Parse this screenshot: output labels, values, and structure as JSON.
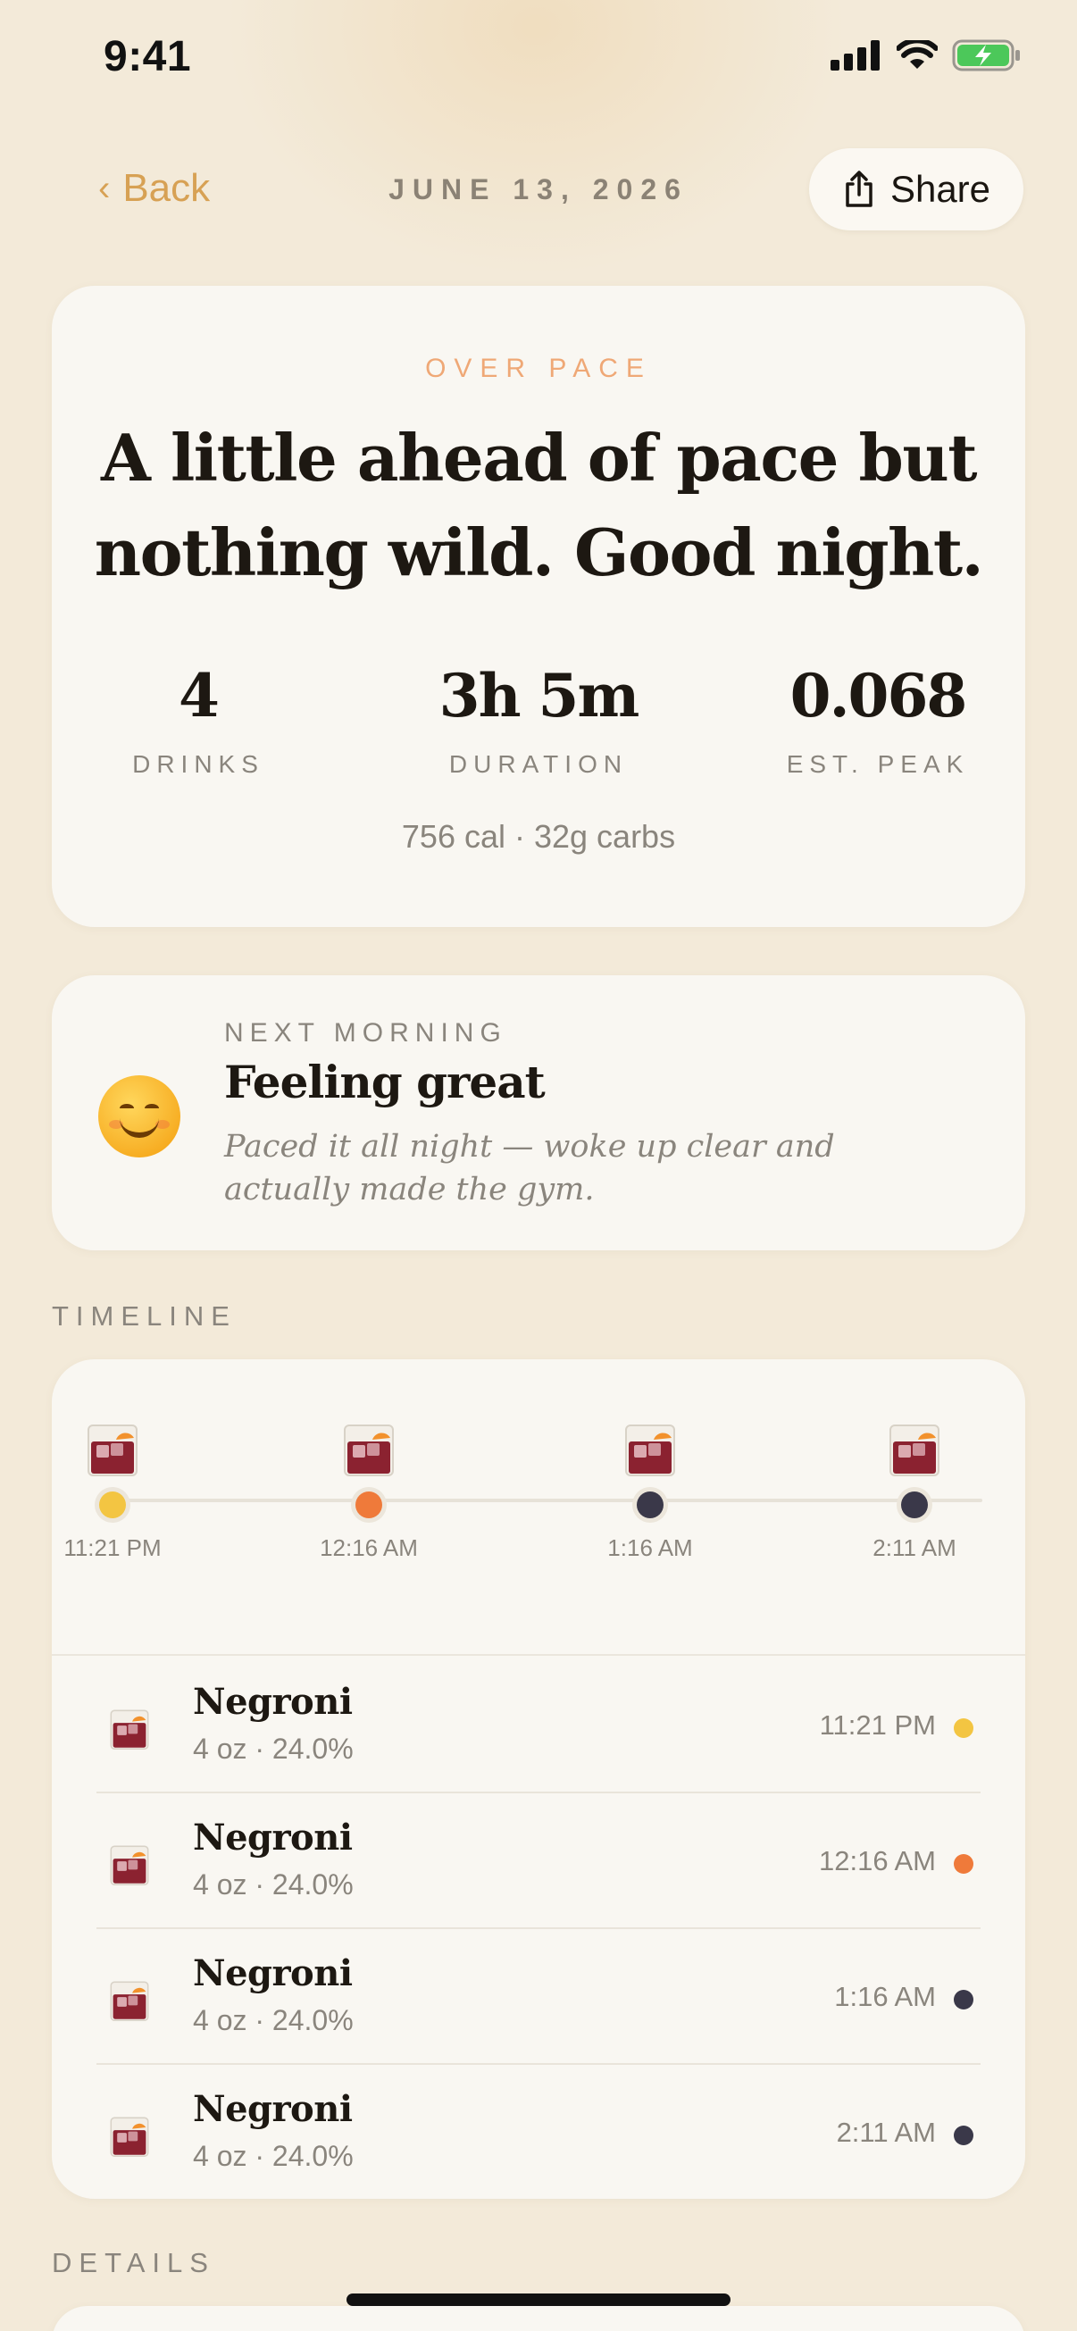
{
  "status_bar": {
    "time": "9:41"
  },
  "header": {
    "back_label": "Back",
    "date": "JUNE 13, 2026",
    "share_label": "Share"
  },
  "summary": {
    "pace_label": "OVER PACE",
    "headline": "A little ahead of pace but nothing wild. Good night.",
    "stats": [
      {
        "value": "4",
        "label": "DRINKS"
      },
      {
        "value": "3h 5m",
        "label": "DURATION"
      },
      {
        "value": "0.068",
        "label": "EST. PEAK"
      }
    ],
    "nutrition": "756 cal · 32g carbs"
  },
  "next_morning": {
    "label": "NEXT MORNING",
    "title": "Feeling great",
    "note": "Paced it all night — woke up clear and actually made the gym.",
    "icon": "smiling-face-emoji"
  },
  "timeline": {
    "section_label": "TIMELINE",
    "markers": [
      {
        "time": "11:21 PM",
        "color": "#f3c542"
      },
      {
        "time": "12:16 AM",
        "color": "#ef7a3a"
      },
      {
        "time": "1:16 AM",
        "color": "#3a3849"
      },
      {
        "time": "2:11 AM",
        "color": "#3a3849"
      }
    ],
    "drinks": [
      {
        "name": "Negroni",
        "detail": "4 oz · 24.0%",
        "time": "11:21 PM",
        "color": "#f3c542"
      },
      {
        "name": "Negroni",
        "detail": "4 oz · 24.0%",
        "time": "12:16 AM",
        "color": "#ef7a3a"
      },
      {
        "name": "Negroni",
        "detail": "4 oz · 24.0%",
        "time": "1:16 AM",
        "color": "#3a3849"
      },
      {
        "name": "Negroni",
        "detail": "4 oz · 24.0%",
        "time": "2:11 AM",
        "color": "#3a3849"
      }
    ]
  },
  "details": {
    "section_label": "DETAILS"
  }
}
